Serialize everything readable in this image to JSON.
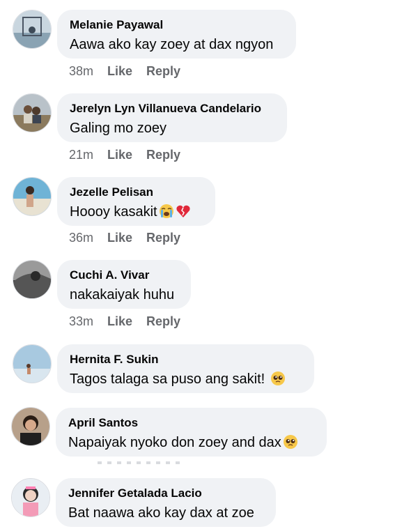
{
  "comments": [
    {
      "name": "Melanie Payawal",
      "text": "Aawa ako kay zoey at dax ngyon",
      "time": "38m",
      "like": "Like",
      "reply": "Reply"
    },
    {
      "name": "Jerelyn Lyn Villanueva Candelario",
      "text": "Galing mo zoey",
      "time": "21m",
      "like": "Like",
      "reply": "Reply"
    },
    {
      "name": "Jezelle Pelisan",
      "text": "Hoooy kasakit",
      "time": "36m",
      "like": "Like",
      "reply": "Reply",
      "emojis": [
        "crying-face",
        "broken-heart"
      ]
    },
    {
      "name": "Cuchi A. Vivar",
      "text": "nakakaiyak huhu",
      "time": "33m",
      "like": "Like",
      "reply": "Reply"
    },
    {
      "name": "Hernita F. Sukin",
      "text": "Tagos talaga sa puso ang sakit!",
      "time": "",
      "like": "",
      "reply": "",
      "emojis": [
        "pleading-face"
      ]
    },
    {
      "name": "April Santos",
      "text": "Napaiyak nyoko don zoey and dax",
      "time": "",
      "like": "",
      "reply": "",
      "emojis": [
        "pleading-face"
      ]
    },
    {
      "name": "Jennifer Getalada Lacio",
      "text": "Bat naawa ako kay dax at zoe",
      "time": "",
      "like": "",
      "reply": ""
    }
  ],
  "colors": {
    "bubble": "#f0f2f5",
    "meta": "#65676b",
    "text": "#050505"
  }
}
